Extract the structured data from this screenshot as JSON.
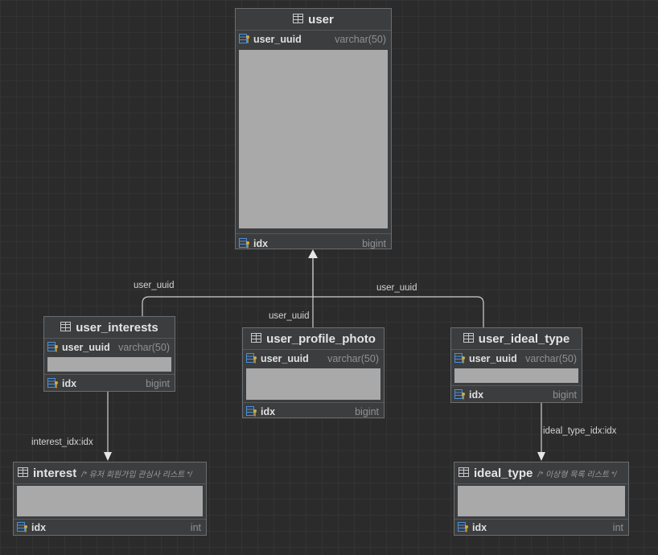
{
  "colors": {
    "background": "#2b2b2b",
    "table_bg": "#3b3d3f",
    "table_border": "#6b6e70",
    "redaction": "#a9a9a9",
    "key_blue": "#4a90d9",
    "key_yellow": "#d8a93a",
    "edge": "#cfcfcf"
  },
  "icons": {
    "table": "table-grid-icon",
    "pk": "primary-key-column-icon",
    "fk": "foreign-key-column-icon"
  },
  "tables": {
    "user": {
      "name": "user",
      "fields": [
        {
          "name": "user_uuid",
          "type": "varchar(50)",
          "icon": "pk"
        },
        {
          "name": "idx",
          "type": "bigint",
          "icon": "fk"
        }
      ]
    },
    "user_interests": {
      "name": "user_interests",
      "fields": [
        {
          "name": "user_uuid",
          "type": "varchar(50)",
          "icon": "fk"
        },
        {
          "name": "idx",
          "type": "bigint",
          "icon": "fk"
        }
      ]
    },
    "user_profile_photo": {
      "name": "user_profile_photo",
      "fields": [
        {
          "name": "user_uuid",
          "type": "varchar(50)",
          "icon": "fk"
        },
        {
          "name": "idx",
          "type": "bigint",
          "icon": "fk"
        }
      ]
    },
    "user_ideal_type": {
      "name": "user_ideal_type",
      "fields": [
        {
          "name": "user_uuid",
          "type": "varchar(50)",
          "icon": "fk"
        },
        {
          "name": "idx",
          "type": "bigint",
          "icon": "fk"
        }
      ]
    },
    "interest": {
      "name": "interest",
      "comment": "/* 유저 회원가입 관심사 리스트 */",
      "fields": [
        {
          "name": "idx",
          "type": "int",
          "icon": "fk"
        }
      ]
    },
    "ideal_type": {
      "name": "ideal_type",
      "comment": "/* 이상형 목록 리스트 */",
      "fields": [
        {
          "name": "idx",
          "type": "int",
          "icon": "fk"
        }
      ]
    }
  },
  "edges": [
    {
      "from": "user_interests",
      "to": "user",
      "label": "user_uuid"
    },
    {
      "from": "user_profile_photo",
      "to": "user",
      "label": "user_uuid"
    },
    {
      "from": "user_ideal_type",
      "to": "user",
      "label": "user_uuid"
    },
    {
      "from": "user_interests",
      "to": "interest",
      "label": "interest_idx:idx"
    },
    {
      "from": "user_ideal_type",
      "to": "ideal_type",
      "label": "ideal_type_idx:idx"
    }
  ]
}
